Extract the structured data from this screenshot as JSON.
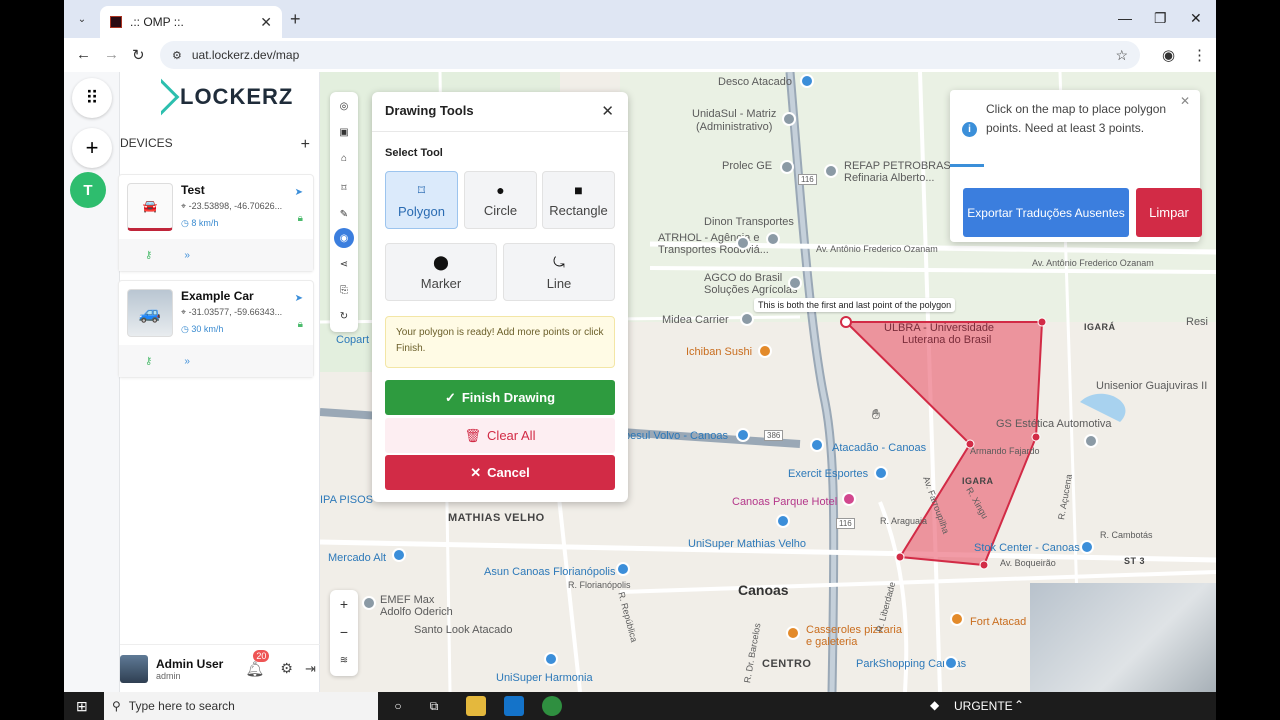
{
  "browser": {
    "tab_title": ".:: OMP ::.",
    "url": "uat.lockerz.dev/map"
  },
  "app": {
    "logo": "LOCKERZ",
    "devices_header": "DEVICES",
    "rail_avatar_letter": "T",
    "devices": [
      {
        "name": "Test",
        "coords": "-23.53898, -46.70626...",
        "speed": "8 km/h"
      },
      {
        "name": "Example Car",
        "coords": "-31.03577, -59.66343...",
        "speed": "30 km/h"
      }
    ],
    "user": {
      "name": "Admin User",
      "role": "admin",
      "notifications": "20"
    }
  },
  "drawing_tools": {
    "title": "Drawing Tools",
    "select_tool_label": "Select Tool",
    "tools": [
      {
        "label": "Polygon",
        "icon": "polygon-icon",
        "selected": true
      },
      {
        "label": "Circle",
        "icon": "circle-icon",
        "selected": false
      },
      {
        "label": "Rectangle",
        "icon": "square-icon",
        "selected": false
      },
      {
        "label": "Marker",
        "icon": "pin-icon",
        "selected": false
      },
      {
        "label": "Line",
        "icon": "route-icon",
        "selected": false
      }
    ],
    "notice": "Your polygon is ready! Add more points or click Finish.",
    "finish_label": "Finish Drawing",
    "clear_label": "Clear All",
    "cancel_label": "Cancel"
  },
  "toast": {
    "message": "Click on the map to place polygon points. Need at least 3 points.",
    "export_label": "Exportar Traduções Ausentes",
    "clear_label": "Limpar"
  },
  "map": {
    "tooltip": "This is both the first and last point of the polygon",
    "labels": {
      "desco": "Desco Atacado",
      "unidasul": "UnidaSul - Matriz",
      "unidasul2": "(Administrativo)",
      "prolec": "Prolec GE",
      "refap": "REFAP PETROBRAS",
      "refap2": "Refinaria Alberto...",
      "dinon": "Dinon Transportes",
      "atrhol": "ATRHOL - Agência e",
      "atrhol2": "Transportes Rodoviá...",
      "agco": "AGCO do Brasil",
      "agco2": "Soluções Agrícolas",
      "avantonio": "Av. Antônio Frederico Ozanam",
      "avantonio2": "Av. Antônio Frederico Ozanam",
      "midea": "Midea Carrier",
      "ulbra": "ULBRA - Universidade",
      "ulbra2": "Luterana do Brasil",
      "igara1": "IGARÁ",
      "igara2": "IGARA",
      "resi": "Resi",
      "unisergua": "Unisenior Guajuviras II",
      "ichiban": "Ichiban Sushi",
      "gsestetica": "GS Estética Automotiva",
      "volvo": "pesul Volvo - Canoas",
      "atacadao": "Atacadão - Canoas",
      "armando": "Armando Fajardo",
      "exercit": "Exercit Esportes",
      "canoashotel": "Canoas Parque Hotel",
      "ipa": "IPA PISOS",
      "matias": "MATHIAS VELHO",
      "araguaia": "R. Araguaia",
      "xingu": "R. Xingu",
      "farroupilha": "Av. Farroupilha",
      "unisuper1": "UniSuper Mathias Velho",
      "stokcenter": "Stok Center - Canoas",
      "boqueirao": "Av. Boqueirão",
      "mercado": "Mercado Alt",
      "asun": "Asun Canoas Florianópolis",
      "florianopolis": "R. Florianópolis",
      "canoas": "Canoas",
      "emef": "EMEF Max",
      "emef2": "Adolfo Oderich",
      "santolook": "Santo Look Atacado",
      "casseroles": "Casseroles pizzaria",
      "casseroles2": "e galeteria",
      "fortatacad": "Fort Atacad",
      "centro": "CENTRO",
      "parkshopping": "ParkShopping Canoas",
      "unisuper2": "UniSuper Harmonia",
      "copart": "Copart",
      "acucena": "R. Açucena",
      "cambotas": "R. Cambotás",
      "st3": "ST 3",
      "liberdade": "R. Liberdade",
      "republica": "R. República",
      "barros": "R. Dr. Barcelos",
      "route116a": "116",
      "route116b": "116",
      "route386": "386"
    }
  },
  "taskbar": {
    "search_placeholder": "Type here to search",
    "tray_label": "URGENTE"
  },
  "colors": {
    "primary_blue": "#3b7ede",
    "finish_green": "#2e9b3f",
    "cancel_red": "#d22b46",
    "polygon_fill": "#e84a5f",
    "accent_teal": "#2cbfae"
  }
}
